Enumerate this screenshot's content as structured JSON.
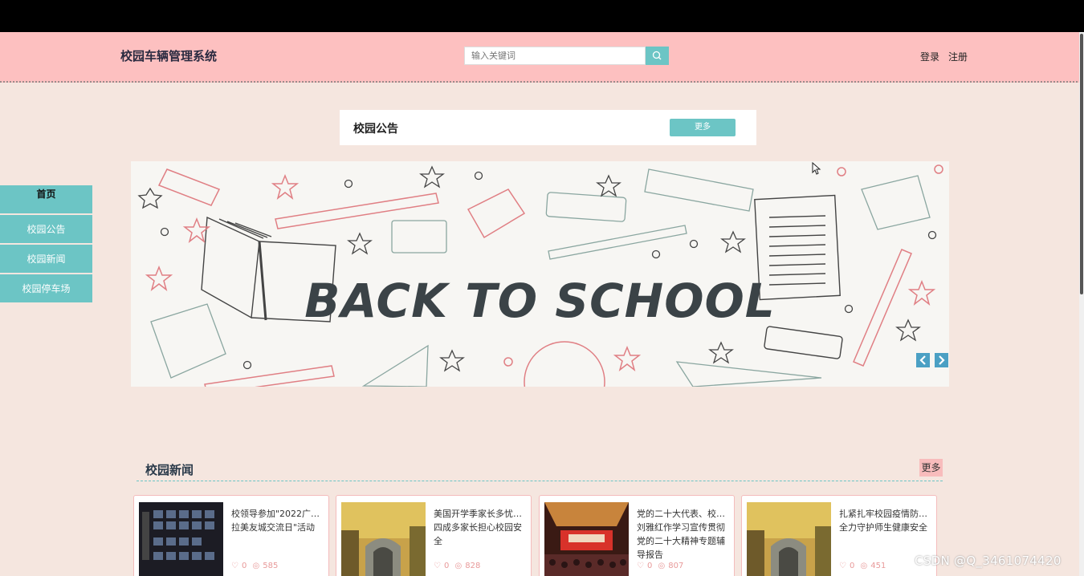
{
  "header": {
    "site_title": "校园车辆管理系统",
    "search_placeholder": "输入关键词",
    "login": "登录",
    "register": "注册"
  },
  "notice": {
    "title": "校园公告",
    "more": "更多"
  },
  "side_nav": {
    "items": [
      {
        "label": "首页"
      },
      {
        "label": "校园公告"
      },
      {
        "label": "校园新闻"
      },
      {
        "label": "校园停车场"
      }
    ]
  },
  "banner": {
    "text": "BACK TO SCHOOL"
  },
  "news": {
    "title": "校园新闻",
    "more": "更多",
    "cards": [
      {
        "title": "校领导参加\"2022广…拉美友城交流日\"活动",
        "likes": "0",
        "views": "585"
      },
      {
        "title": "美国开学季家长多忧…四成多家长担心校园安全",
        "likes": "0",
        "views": "828"
      },
      {
        "title": "党的二十大代表、校…刘雅红作学习宣传贯彻党的二十大精神专题辅导报告",
        "likes": "0",
        "views": "807"
      },
      {
        "title": "扎紧扎牢校园疫情防…全力守护师生健康安全",
        "likes": "0",
        "views": "451"
      }
    ]
  },
  "watermark": "CSDN @Q_3461074420",
  "colors": {
    "header_bg": "#fdc0c0",
    "accent": "#6cc5c5",
    "page_bg": "#f5e6df"
  }
}
